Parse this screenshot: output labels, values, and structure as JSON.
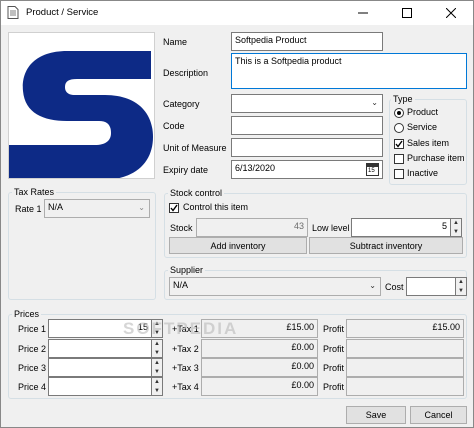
{
  "window": {
    "title": "Product / Service"
  },
  "fields": {
    "name_label": "Name",
    "name_value": "Softpedia Product",
    "description_label": "Description",
    "description_value": "This is a Softpedia product",
    "category_label": "Category",
    "category_value": "",
    "code_label": "Code",
    "code_value": "",
    "unit_label": "Unit of Measure",
    "unit_value": "",
    "expiry_label": "Expiry date",
    "expiry_value": "6/13/2020",
    "calendar_day": "15"
  },
  "type_group": {
    "title": "Type",
    "radios": [
      {
        "label": "Product",
        "checked": true
      },
      {
        "label": "Service",
        "checked": false
      }
    ],
    "checks": [
      {
        "label": "Sales item",
        "checked": true
      },
      {
        "label": "Purchase item",
        "checked": false
      },
      {
        "label": "Inactive",
        "checked": false
      }
    ]
  },
  "tax_rates": {
    "title": "Tax Rates",
    "rate1_label": "Rate 1",
    "rate1_value": "N/A"
  },
  "stock": {
    "title": "Stock control",
    "control_label": "Control this item",
    "control_checked": true,
    "stock_label": "Stock",
    "stock_value": "43",
    "low_level_label": "Low level",
    "low_level_value": "5",
    "add_button": "Add inventory",
    "subtract_button": "Subtract inventory"
  },
  "supplier": {
    "title": "Supplier",
    "value": "N/A",
    "cost_label": "Cost",
    "cost_value": ""
  },
  "prices": {
    "title": "Prices",
    "rows": [
      {
        "label": "Price 1",
        "value": "15",
        "tax_label": "+Tax 1",
        "tax_value": "£15.00",
        "profit_label": "Profit",
        "profit_value": "£15.00"
      },
      {
        "label": "Price 2",
        "value": "",
        "tax_label": "+Tax 2",
        "tax_value": "£0.00",
        "profit_label": "Profit",
        "profit_value": ""
      },
      {
        "label": "Price 3",
        "value": "",
        "tax_label": "+Tax 3",
        "tax_value": "£0.00",
        "profit_label": "Profit",
        "profit_value": ""
      },
      {
        "label": "Price 4",
        "value": "",
        "tax_label": "+Tax 4",
        "tax_value": "£0.00",
        "profit_label": "Profit",
        "profit_value": ""
      }
    ]
  },
  "buttons": {
    "save": "Save",
    "cancel": "Cancel"
  },
  "watermark": "SOFTPEDIA",
  "colors": {
    "logo": "#0d2a86",
    "accent": "#0078d7"
  }
}
